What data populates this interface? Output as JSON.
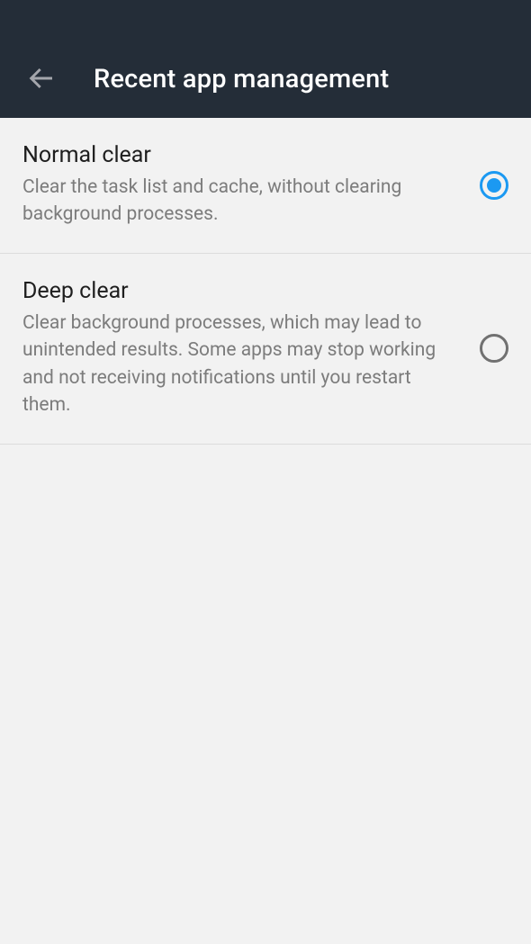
{
  "header": {
    "title": "Recent app management"
  },
  "options": [
    {
      "title": "Normal clear",
      "description": "Clear the task list and cache, without clearing background processes.",
      "selected": true
    },
    {
      "title": "Deep clear",
      "description": "Clear background processes, which may lead to unintended results. Some apps may stop working and not receiving notifications until you restart them.",
      "selected": false
    }
  ]
}
